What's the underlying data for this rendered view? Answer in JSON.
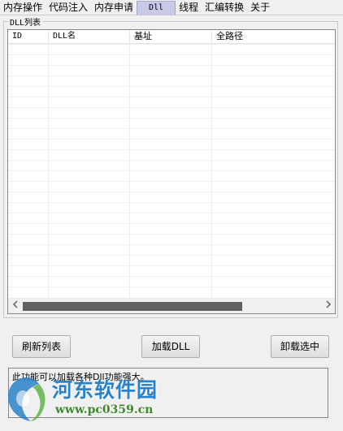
{
  "tabs": [
    {
      "label": "内存操作"
    },
    {
      "label": "代码注入"
    },
    {
      "label": "内存申请"
    },
    {
      "label": "Dll",
      "active": true
    },
    {
      "label": "线程"
    },
    {
      "label": "汇编转换"
    },
    {
      "label": "关于"
    }
  ],
  "group": {
    "title": "DLL列表"
  },
  "listview": {
    "columns": [
      "ID",
      "DLL名",
      "基址",
      "全路径"
    ],
    "rows": []
  },
  "scrollbar": {
    "left_icon": "chevron-left-icon",
    "right_icon": "chevron-right-icon"
  },
  "buttons": {
    "refresh": "刷新列表",
    "load": "加载DLL",
    "unload": "卸载选中"
  },
  "status": {
    "text": "此功能可以加载各种Dll功能强大。"
  },
  "watermark": {
    "site_name": "河东软件园",
    "url": "www.pc0359.cn"
  },
  "colors": {
    "active_tab": "#c8c8e8",
    "scroll_thumb": "#606060",
    "watermark_blue": "#2a82c8",
    "watermark_green": "#3b8a2a"
  }
}
